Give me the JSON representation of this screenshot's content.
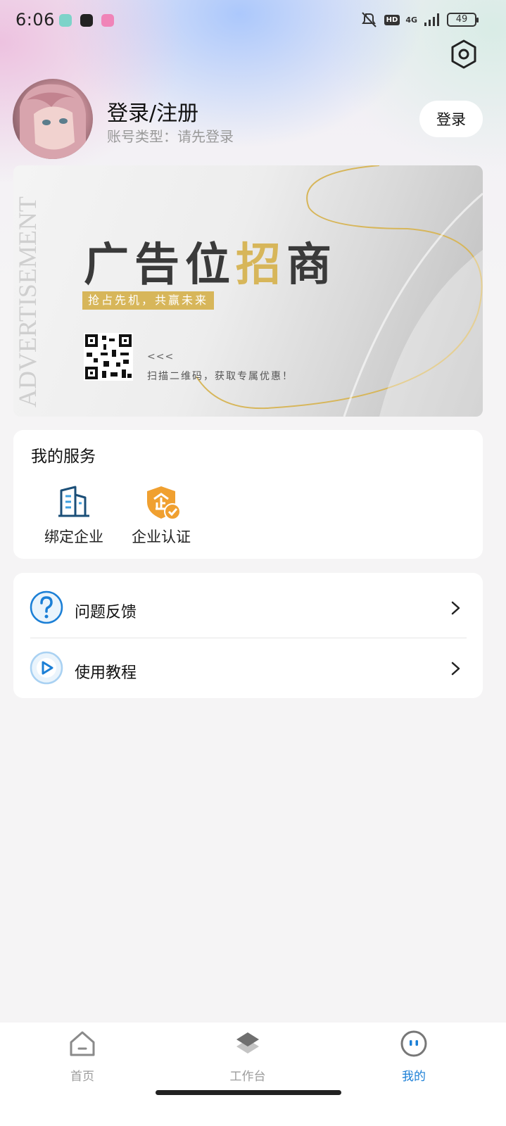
{
  "status_bar": {
    "time": "6:06",
    "battery": "49",
    "network": "4G",
    "hd": "HD"
  },
  "profile": {
    "name": "登录/注册",
    "account_type": "账号类型：请先登录",
    "login_button": "登录"
  },
  "ad": {
    "side_text": "ADVERTISEMENT",
    "headline_part1": "广告位",
    "headline_highlight": "招",
    "headline_part2": "商",
    "tagline": "抢占先机，共赢未来",
    "arrows": "<<<",
    "scan_text": "扫描二维码，获取专属优惠！"
  },
  "services": {
    "title": "我的服务",
    "items": [
      {
        "label": "绑定企业",
        "icon": "building-icon"
      },
      {
        "label": "企业认证",
        "icon": "enterprise-certification-icon"
      }
    ]
  },
  "menu": {
    "items": [
      {
        "label": "问题反馈",
        "icon": "question-icon"
      },
      {
        "label": "使用教程",
        "icon": "play-icon"
      }
    ]
  },
  "bottom_nav": {
    "items": [
      {
        "label": "首页",
        "icon": "home-icon",
        "active": false
      },
      {
        "label": "工作台",
        "icon": "layers-icon",
        "active": false
      },
      {
        "label": "我的",
        "icon": "profile-face-icon",
        "active": true
      }
    ]
  },
  "colors": {
    "accent_blue": "#1b7fd6",
    "ad_gold": "#d7b65a",
    "certification_orange": "#f0a030"
  }
}
